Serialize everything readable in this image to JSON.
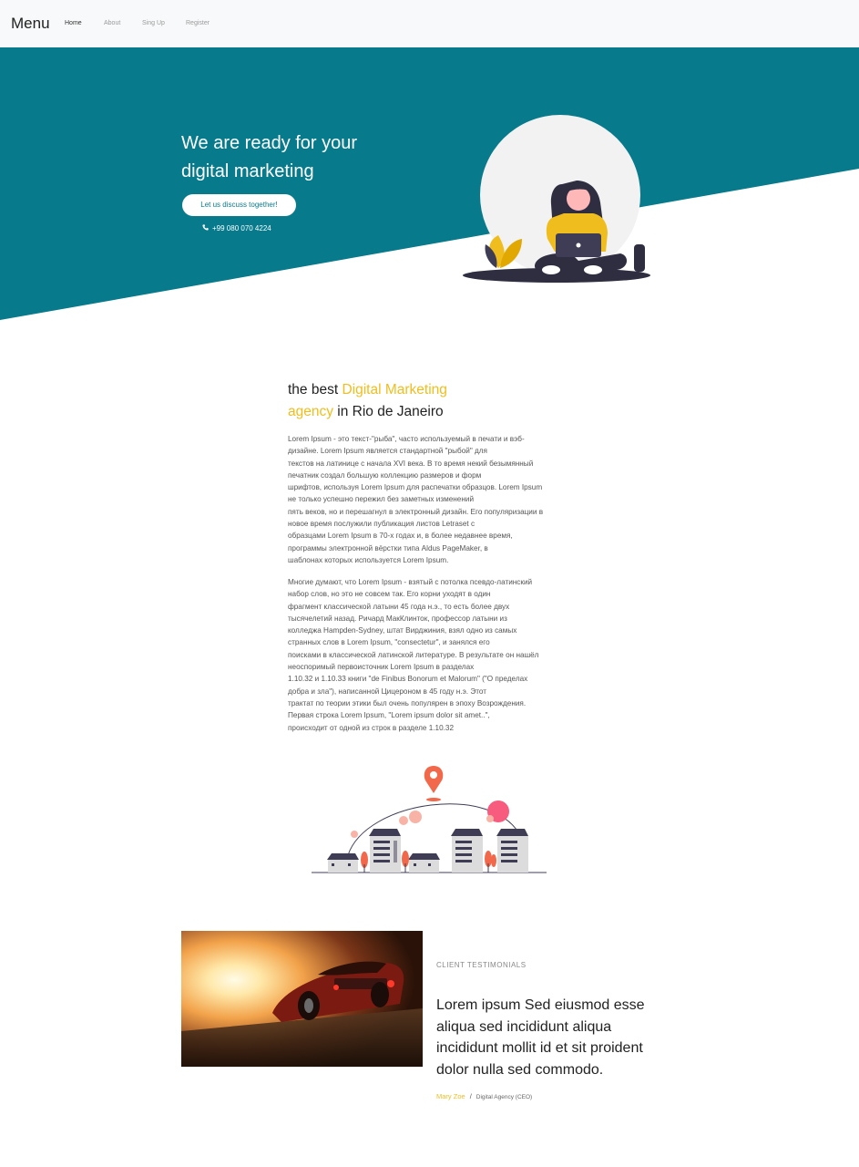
{
  "nav": {
    "brand": "Menu",
    "links": [
      "Home",
      "About",
      "Sing Up",
      "Register"
    ]
  },
  "hero": {
    "title_line1": "We are ready for your",
    "title_line2": "digital marketing",
    "cta": "Let us discuss together!",
    "phone": "+99 080 070 4224",
    "phone_icon": "phone-icon",
    "background_color": "#077a8c"
  },
  "about": {
    "title_pre": "the best ",
    "title_highlight1": "Digital Marketing",
    "title_highlight2": "agency",
    "title_post": " in Rio de Janeiro",
    "highlight_color": "#f0bd1e",
    "p1_lines": [
      "Lorem Ipsum - это текст-\"рыба\", часто используемый в печати и вэб-",
      "дизайне. Lorem Ipsum является стандартной \"рыбой\" для",
      "текстов на латинице с начала XVI века. В то время некий безымянный",
      "печатник создал большую коллекцию размеров и форм",
      "шрифтов, используя Lorem Ipsum для распечатки образцов. Lorem Ipsum",
      "не только успешно пережил без заметных изменений",
      "пять веков, но и перешагнул в электронный дизайн. Его популяризации в",
      "новое время послужили публикация листов Letraset с",
      "образцами Lorem Ipsum в 70-х годах и, в более недавнее время,",
      "программы электронной вёрстки типа Aldus PageMaker, в",
      "шаблонах которых используется Lorem Ipsum."
    ],
    "p2_lines": [
      "Многие думают, что Lorem Ipsum - взятый с потолка псевдо-латинский",
      "набор слов, но это не совсем так. Его корни уходят в один",
      "фрагмент классической латыни 45 года н.э., то есть более двух",
      "тысячелетий назад. Ричард МакКлинток, профессор латыни из",
      "колледжа Hampden-Sydney, штат Вирджиния, взял одно из самых",
      "странных слов в Lorem Ipsum, \"consectetur\", и занялся его",
      "поисками в классической латинской литературе. В результате он нашёл",
      "неоспоримый первоисточник Lorem Ipsum в разделах",
      "1.10.32 и 1.10.33 книги \"de Finibus Bonorum et Malorum\" (\"О пределах",
      "добра и зла\"), написанной Цицероном в 45 году н.э. Этот",
      "трактат по теории этики был очень популярен в эпоху Возрождения.",
      "Первая строка Lorem Ipsum, \"Lorem ipsum dolor sit amet..\",",
      "происходит от одной из строк в разделе 1.10.32"
    ]
  },
  "testimonial": {
    "label": "CLIENT TESTIMONIALS",
    "quote_lines": [
      "Lorem ipsum Sed eiusmod esse",
      "aliqua sed incididunt aliqua",
      "incididunt mollit id et sit proident",
      "dolor nulla sed commodo."
    ],
    "author": "Mary Zoe",
    "separator": "/",
    "role": "Digital Agency (CEO)"
  }
}
